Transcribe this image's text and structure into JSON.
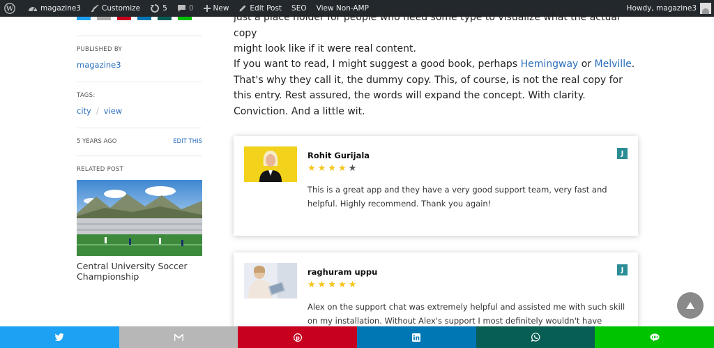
{
  "adminbar": {
    "site_name": "magazine3",
    "customize": "Customize",
    "updates_count": "5",
    "comments_count": "0",
    "new_label": "New",
    "edit_post": "Edit Post",
    "seo": "SEO",
    "view_non_amp": "View Non-AMP",
    "howdy": "Howdy, magazine3"
  },
  "sidebar": {
    "published_by_label": "PUBLISHED BY",
    "author": "magazine3",
    "tags_label": "TAGS:",
    "tags": [
      "city",
      "view"
    ],
    "tag_separator": "/",
    "date": "5 YEARS AGO",
    "edit_this": "EDIT THIS",
    "related_label": "RELATED POST",
    "related_title": "Central University Soccer Championship"
  },
  "article": {
    "para1_line1": "just a place holder for people who need some type to visualize what the actual copy",
    "para1_line2": "might look like if it were real content.",
    "para2_start": "If you want to read, I might suggest a good book, perhaps ",
    "link_hemingway": "Hemingway",
    "word_or": " or ",
    "link_melville": "Melville",
    "para2_rest": ". That's why they call it, the dummy copy. This, of course, is not the real copy for this entry. Rest assured, the words will expand the concept. With clarity. Conviction. And a little wit."
  },
  "reviews": [
    {
      "name": "Rohit Gurijala",
      "rating": 4,
      "max_rating": 5,
      "text": "This is a great app and they have a very good support team, very fast and helpful. Highly recommend. Thank you again!",
      "badge": "J"
    },
    {
      "name": "raghuram uppu",
      "rating": 5,
      "max_rating": 5,
      "text": "Alex on the support chat was extremely helpful and assisted me with such skill on my installation. Without Alex's support I most definitely wouldn't have",
      "badge": "J"
    }
  ],
  "share_buttons": [
    {
      "network": "twitter",
      "icon": "twitter-icon",
      "color": "#1da1f2"
    },
    {
      "network": "gmail",
      "icon": "gmail-icon",
      "color": "#b7b7b7"
    },
    {
      "network": "pinterest",
      "icon": "pinterest-icon",
      "color": "#c8001f"
    },
    {
      "network": "linkedin",
      "icon": "linkedin-icon",
      "color": "#0077b5"
    },
    {
      "network": "whatsapp",
      "icon": "whatsapp-icon",
      "color": "#075e54"
    },
    {
      "network": "line",
      "icon": "line-icon",
      "color": "#00c300"
    }
  ],
  "colors": {
    "adminbar_bg": "#23282d",
    "link": "#2a6ebb",
    "star_filled": "#f5c518",
    "star_empty": "#555555",
    "badge": "#2b8d95",
    "scroll_top": "#8a8a8a"
  }
}
